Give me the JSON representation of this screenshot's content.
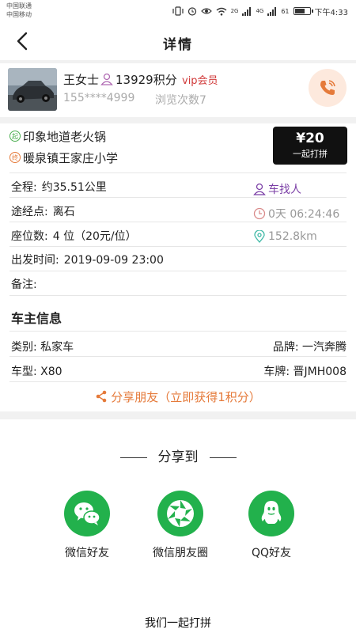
{
  "status_bar": {
    "carrier1": "中国联通",
    "carrier2": "中国移动",
    "signal1": "2G",
    "signal2": "4G",
    "battery": "61",
    "time": "下午4:33"
  },
  "nav": {
    "title": "详情"
  },
  "user": {
    "name": "王女士",
    "points": "13929积分",
    "vip": "vip会员",
    "phone": "155****4999",
    "views": "浏览次数7"
  },
  "route": {
    "start_tag": "起",
    "start": "印象地道老火锅",
    "end_tag": "终",
    "end": "暖泉镇王家庄小学"
  },
  "price": {
    "amount": "¥20",
    "label": "一起打拼"
  },
  "details": {
    "distance_label": "全程:",
    "distance": "约35.51公里",
    "via_label": "途经点:",
    "via": "离石",
    "seats_label": "座位数:",
    "seats": "4 位（20元/位）",
    "depart_label": "出发时间:",
    "depart": "2019-09-09 23:00",
    "note_label": "备注:",
    "note": "",
    "role": "车找人",
    "countdown": "0天 06:24:46",
    "distance_away": "152.8km"
  },
  "owner": {
    "title": "车主信息",
    "type_label": "类别:",
    "type": "私家车",
    "brand_label": "品牌:",
    "brand": "一汽奔腾",
    "model_label": "车型:",
    "model": "X80",
    "plate_label": "车牌:",
    "plate": "晋JMH008"
  },
  "share_link": "分享朋友（立即获得1积分）",
  "share_sheet": {
    "title": "分享到",
    "items": [
      {
        "label": "微信好友",
        "icon": "wechat-icon"
      },
      {
        "label": "微信朋友圈",
        "icon": "moments-icon"
      },
      {
        "label": "QQ好友",
        "icon": "qq-icon"
      }
    ]
  },
  "footer": "我们一起打拼",
  "colors": {
    "accent_orange": "#e57a3a",
    "vip_red": "#d13a3a",
    "role_purple": "#7b3fa6",
    "share_green": "#22b14c",
    "price_bg": "#111111"
  }
}
